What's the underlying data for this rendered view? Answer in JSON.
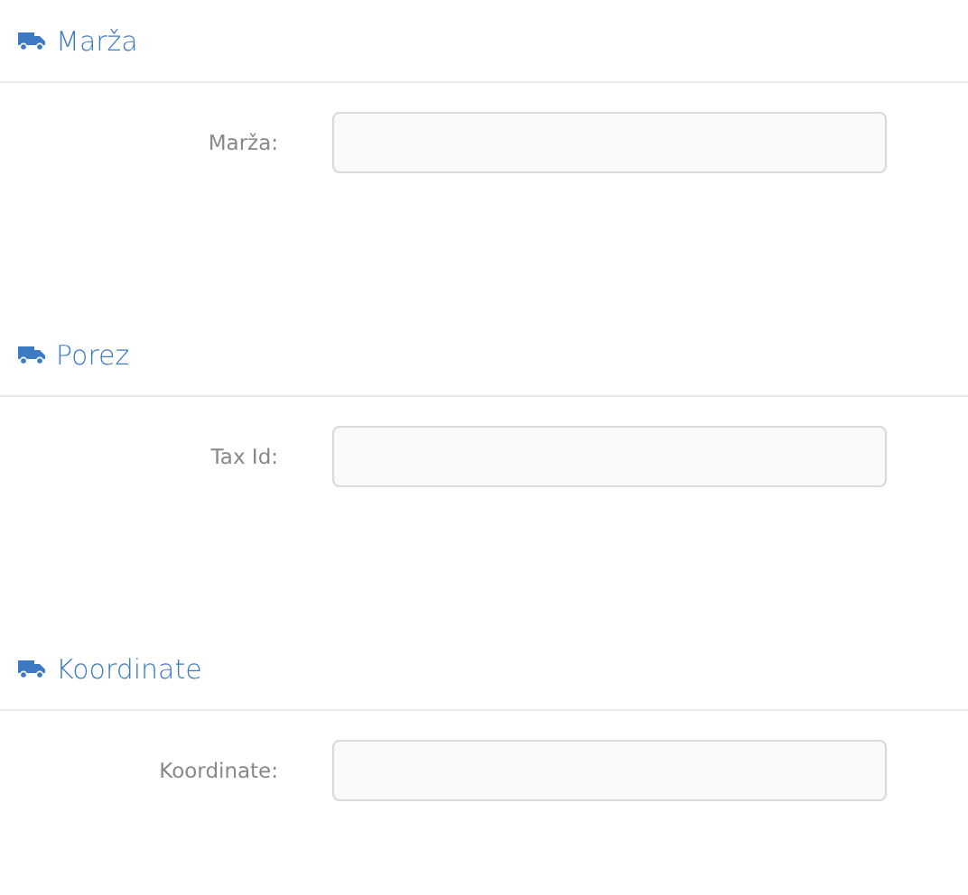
{
  "sections": [
    {
      "title": "Marža",
      "field": {
        "label": "Marža:"
      }
    },
    {
      "title": "Porez",
      "field": {
        "label": "Tax Id:"
      }
    },
    {
      "title": "Koordinate",
      "field": {
        "label": "Koordinate:"
      }
    }
  ]
}
